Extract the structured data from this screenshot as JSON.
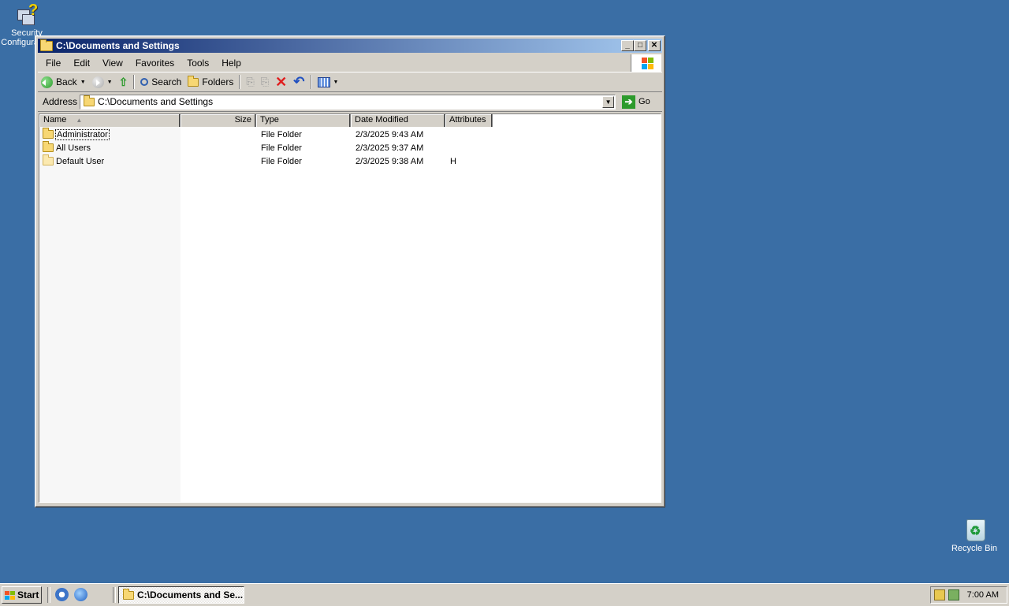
{
  "desktop": {
    "security_label": "Security Configuration",
    "recycle_label": "Recycle Bin"
  },
  "window": {
    "title": "C:\\Documents and Settings",
    "menus": [
      "File",
      "Edit",
      "View",
      "Favorites",
      "Tools",
      "Help"
    ],
    "toolbar": {
      "back": "Back",
      "search": "Search",
      "folders": "Folders"
    },
    "address": {
      "label": "Address",
      "value": "C:\\Documents and Settings",
      "go": "Go"
    },
    "columns": {
      "name": "Name",
      "size": "Size",
      "type": "Type",
      "date": "Date Modified",
      "attributes": "Attributes"
    },
    "rows": [
      {
        "name": "Administrator",
        "size": "",
        "type": "File Folder",
        "date": "2/3/2025 9:43 AM",
        "attr": ""
      },
      {
        "name": "All Users",
        "size": "",
        "type": "File Folder",
        "date": "2/3/2025 9:37 AM",
        "attr": ""
      },
      {
        "name": "Default User",
        "size": "",
        "type": "File Folder",
        "date": "2/3/2025 9:38 AM",
        "attr": "H"
      }
    ]
  },
  "taskbar": {
    "start": "Start",
    "task_title": "C:\\Documents and Se...",
    "clock": "7:00 AM"
  },
  "colors": {
    "desktop": "#3a6ea5",
    "title_start": "#0a246a",
    "title_end": "#a6caf0",
    "face": "#d4d0c8"
  }
}
